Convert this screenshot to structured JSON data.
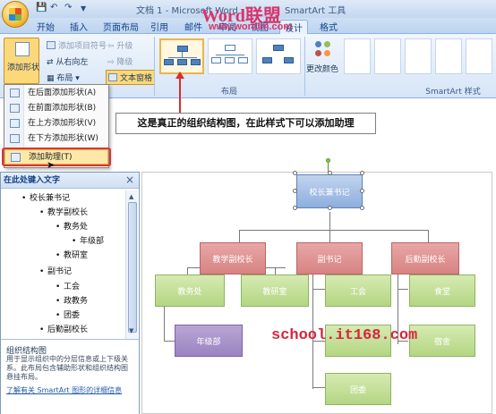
{
  "title_bar": {
    "doc_title": "文档 1 - Microsoft Word",
    "contextual_title": "SmartArt 工具",
    "qat": [
      "save-icon",
      "undo-icon",
      "redo-icon"
    ]
  },
  "watermark": {
    "brand": "Word联盟",
    "url": "www.wordlm.com",
    "school": "school.it168.com"
  },
  "tabs": [
    {
      "label": "开始"
    },
    {
      "label": "插入"
    },
    {
      "label": "页面布局"
    },
    {
      "label": "引用"
    },
    {
      "label": "邮件"
    },
    {
      "label": "审阅"
    },
    {
      "label": "视图"
    },
    {
      "label": "设计"
    },
    {
      "label": "格式"
    }
  ],
  "ribbon": {
    "add_shape_label": "添加形状",
    "add_bullet": "添加项目符号",
    "right_to_left": "从右向左",
    "layout_btn": "布局",
    "promote": "升级",
    "demote": "降级",
    "text_pane": "文本窗格",
    "layouts_group_label": "布局",
    "change_colors": "更改颜色",
    "smartart_styles_label": "SmartArt 样式"
  },
  "menu": {
    "items": [
      {
        "label": "在后面添加形状(A)"
      },
      {
        "label": "在前面添加形状(B)"
      },
      {
        "label": "在上方添加形状(V)"
      },
      {
        "label": "在下方添加形状(W)"
      },
      {
        "label": "添加助理(T)"
      }
    ]
  },
  "callout": {
    "text": "这是真正的组织结构图，在此样式下可以添加助理"
  },
  "text_pane": {
    "header": "在此处键入文字",
    "items": [
      {
        "text": "校长兼书记"
      },
      {
        "text": "教学副校长"
      },
      {
        "text": "教务处"
      },
      {
        "text": "年级部"
      },
      {
        "text": "教研室"
      },
      {
        "text": "副书记"
      },
      {
        "text": "工会"
      },
      {
        "text": "政教务"
      },
      {
        "text": "团委"
      },
      {
        "text": "后勤副校长"
      }
    ],
    "desc_title": "组织结构图",
    "desc_body": "用于显示组织中的分层信息或上下级关系。此布局包含辅助形状和组织结构图悬挂布局。",
    "desc_link": "了解有关 SmartArt 图形的详细信息"
  },
  "chart": {
    "root": "校长兼书记",
    "level1": [
      "教学副校长",
      "副书记",
      "后勤副校长"
    ],
    "level2": [
      "教务处",
      "教研室",
      "工会",
      "食堂"
    ],
    "level3": [
      "年级部",
      "宿舍",
      "团委"
    ]
  }
}
